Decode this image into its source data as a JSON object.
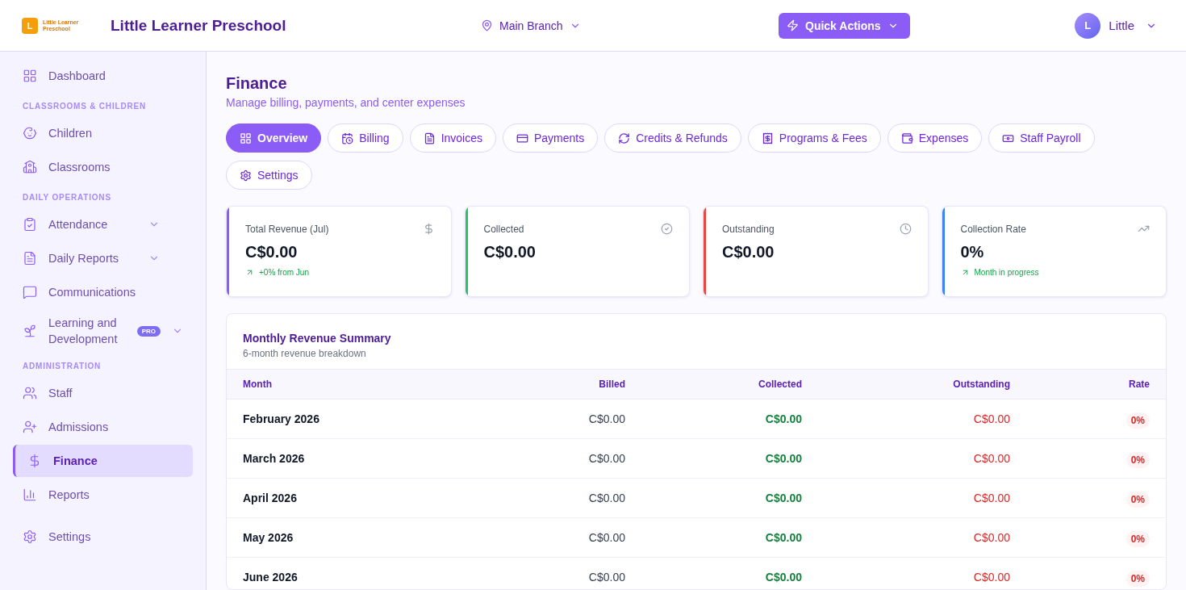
{
  "header": {
    "logo_text": "Little Learner Preschool",
    "logo_letter": "L",
    "school_name": "Little Learner Preschool",
    "branch": "Main Branch",
    "quick_actions": "Quick Actions",
    "user": {
      "initial": "L",
      "name": "Little"
    }
  },
  "sidebar": {
    "sections": [
      {
        "items": [
          {
            "label": "Dashboard",
            "selected": false,
            "has_submenu": false
          }
        ]
      },
      {
        "title": "CLASSROOMS & CHILDREN",
        "items": [
          {
            "label": "Children",
            "selected": false,
            "has_submenu": false
          },
          {
            "label": "Classrooms",
            "selected": false,
            "has_submenu": false
          }
        ]
      },
      {
        "title": "DAILY OPERATIONS",
        "items": [
          {
            "label": "Attendance",
            "selected": false,
            "has_submenu": true
          },
          {
            "label": "Daily Reports",
            "selected": false,
            "has_submenu": true
          },
          {
            "label": "Communications",
            "selected": false,
            "has_submenu": false
          },
          {
            "label": "Learning and Development",
            "selected": false,
            "has_submenu": true,
            "badge": "PRO"
          }
        ]
      },
      {
        "title": "ADMINISTRATION",
        "items": [
          {
            "label": "Staff",
            "selected": false,
            "has_submenu": false
          },
          {
            "label": "Admissions",
            "selected": false,
            "has_submenu": false
          },
          {
            "label": "Finance",
            "selected": true,
            "has_submenu": false
          },
          {
            "label": "Reports",
            "selected": false,
            "has_submenu": false
          }
        ]
      },
      {
        "items": [
          {
            "label": "Settings",
            "selected": false,
            "has_submenu": false
          }
        ]
      }
    ]
  },
  "page": {
    "title": "Finance",
    "subtitle": "Manage billing, payments, and center expenses"
  },
  "tabs": [
    {
      "label": "Overview",
      "selected": true
    },
    {
      "label": "Billing",
      "selected": false
    },
    {
      "label": "Invoices",
      "selected": false
    },
    {
      "label": "Payments",
      "selected": false
    },
    {
      "label": "Credits & Refunds",
      "selected": false
    },
    {
      "label": "Programs & Fees",
      "selected": false
    },
    {
      "label": "Expenses",
      "selected": false
    },
    {
      "label": "Staff Payroll",
      "selected": false
    },
    {
      "label": "Settings",
      "selected": false
    }
  ],
  "cards": [
    {
      "label": "Total Revenue (Jul)",
      "value": "C$0.00",
      "trend": "+0% from Jun",
      "color": "#8b5cf6"
    },
    {
      "label": "Collected",
      "value": "C$0.00",
      "color": "#22c55e"
    },
    {
      "label": "Outstanding",
      "value": "C$0.00",
      "color": "#ef4444"
    },
    {
      "label": "Collection Rate",
      "value": "0%",
      "trend": "Month in progress",
      "color": "#3b82f6"
    }
  ],
  "summary": {
    "title": "Monthly Revenue Summary",
    "subtitle": "6-month revenue breakdown",
    "columns": [
      "Month",
      "Billed",
      "Collected",
      "Outstanding",
      "Rate"
    ],
    "rows": [
      {
        "month": "February 2026",
        "billed": "C$0.00",
        "collected": "C$0.00",
        "outstanding": "C$0.00",
        "rate": "0%"
      },
      {
        "month": "March 2026",
        "billed": "C$0.00",
        "collected": "C$0.00",
        "outstanding": "C$0.00",
        "rate": "0%"
      },
      {
        "month": "April 2026",
        "billed": "C$0.00",
        "collected": "C$0.00",
        "outstanding": "C$0.00",
        "rate": "0%"
      },
      {
        "month": "May 2026",
        "billed": "C$0.00",
        "collected": "C$0.00",
        "outstanding": "C$0.00",
        "rate": "0%"
      },
      {
        "month": "June 2026",
        "billed": "C$0.00",
        "collected": "C$0.00",
        "outstanding": "C$0.00",
        "rate": "0%"
      }
    ]
  }
}
